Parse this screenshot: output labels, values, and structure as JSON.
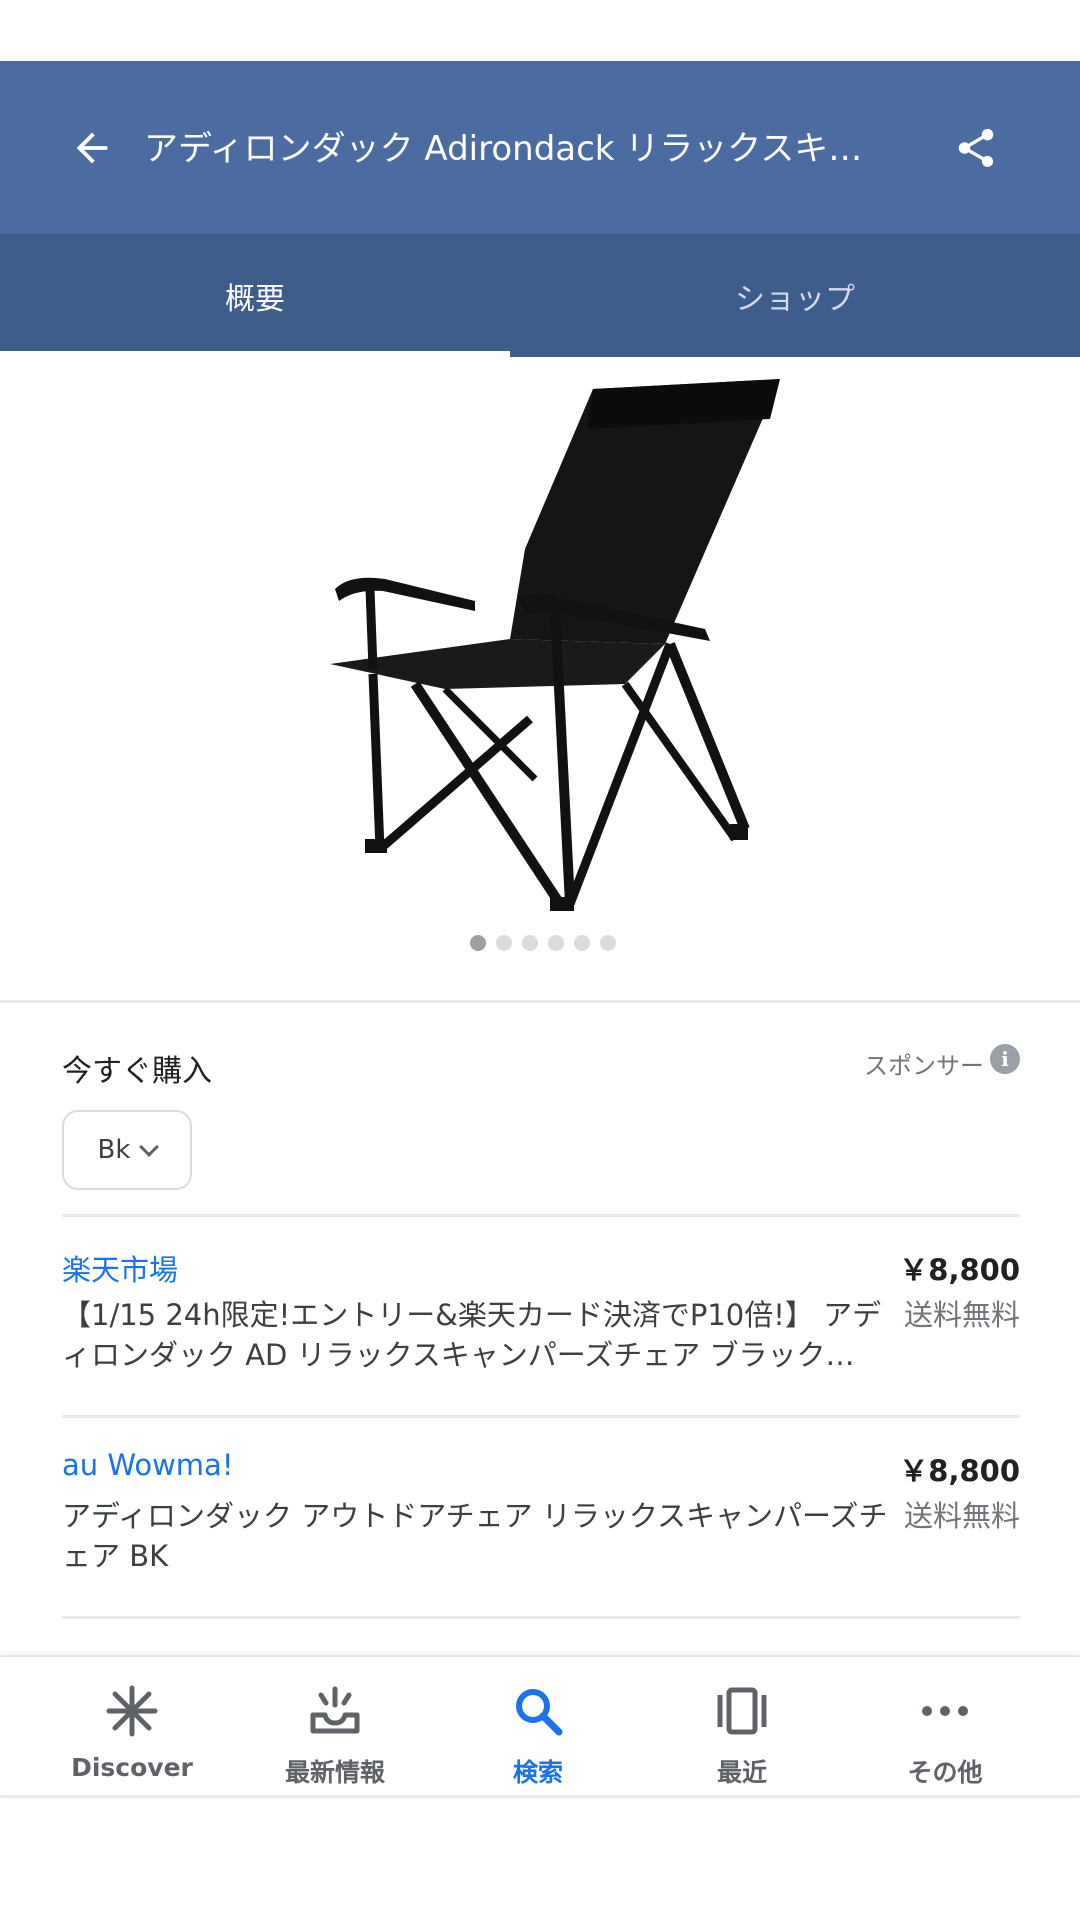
{
  "app_bar": {
    "title": "アディロンダック Adirondack リラックスキャ…",
    "back_icon": "arrow-back-icon",
    "share_icon": "share-icon",
    "color": "#4a6ca0"
  },
  "tabs": [
    {
      "label": "概要",
      "selected": true
    },
    {
      "label": "ショップ",
      "selected": false
    }
  ],
  "gallery": {
    "image": "black-folding-camp-chair",
    "page_count": 6,
    "current_page": 1
  },
  "buy": {
    "title": "今すぐ購入",
    "sponsor_label": "スポンサー",
    "info_icon": "info-icon",
    "variant": "Bk"
  },
  "offers": [
    {
      "store": "楽天市場",
      "price": "￥8,800",
      "description": "【1/15 24h限定!エントリー&楽天カード決済でP10倍!】 アディロンダック AD リラックスキャンパーズチェア ブラック…",
      "shipping": "送料無料"
    },
    {
      "store": "au Wowma!",
      "price": "￥8,800",
      "description": "アディロンダック アウトドアチェア リラックスキャンパーズチェア BK",
      "shipping": "送料無料"
    }
  ],
  "bottom_nav": [
    {
      "label": "Discover",
      "icon": "discover-asterisk-icon",
      "active": false
    },
    {
      "label": "最新情報",
      "icon": "updates-tray-icon",
      "active": false
    },
    {
      "label": "検索",
      "icon": "search-icon",
      "active": true
    },
    {
      "label": "最近",
      "icon": "recent-cards-icon",
      "active": false
    },
    {
      "label": "その他",
      "icon": "more-dots-icon",
      "active": false
    }
  ],
  "colors": {
    "accent": "#1a73e8",
    "tab_bar": "#3d5d8a"
  }
}
